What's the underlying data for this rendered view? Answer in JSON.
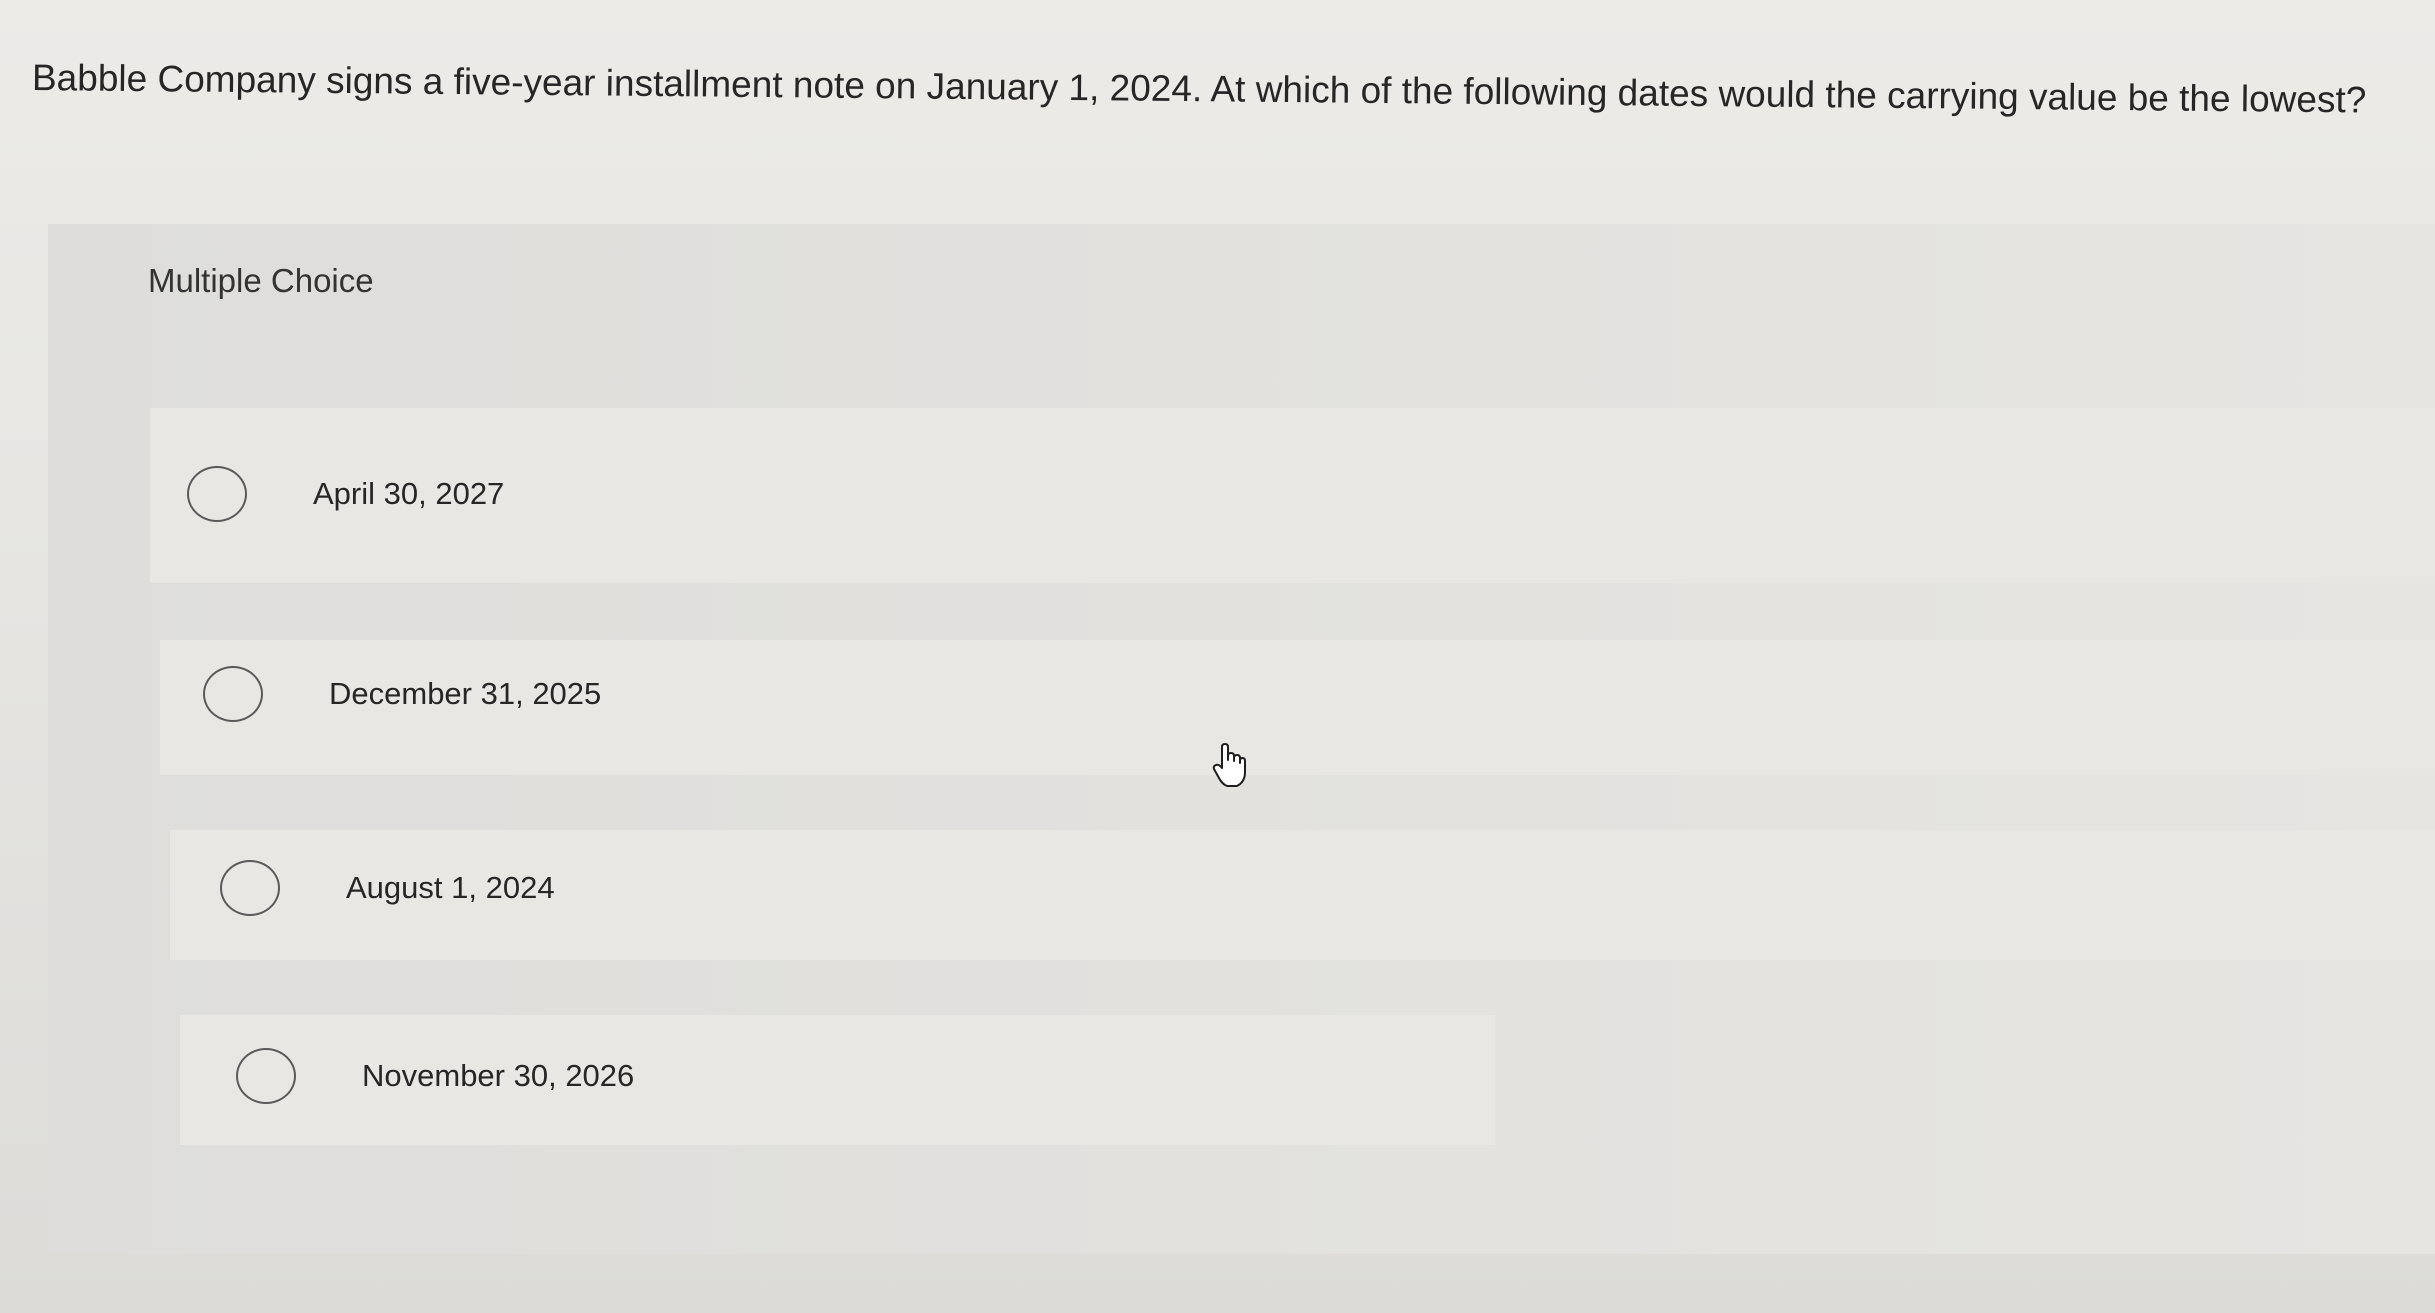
{
  "question": {
    "text": "Babble Company signs a five-year installment note on January 1, 2024. At which of the following dates would the carrying value be the lowest?"
  },
  "multiple_choice": {
    "header": "Multiple Choice",
    "options": [
      {
        "label": "April 30, 2027",
        "selected": false
      },
      {
        "label": "December 31, 2025",
        "selected": false
      },
      {
        "label": "August 1, 2024",
        "selected": false
      },
      {
        "label": "November 30, 2026",
        "selected": false
      }
    ]
  },
  "cursor": {
    "icon": "hand-pointer-icon"
  },
  "colors": {
    "background": "#e6e5e2",
    "panel": "#dedddb",
    "option_band": "#e8e7e4",
    "text": "#262626",
    "radio_border": "#5a5a5a"
  }
}
